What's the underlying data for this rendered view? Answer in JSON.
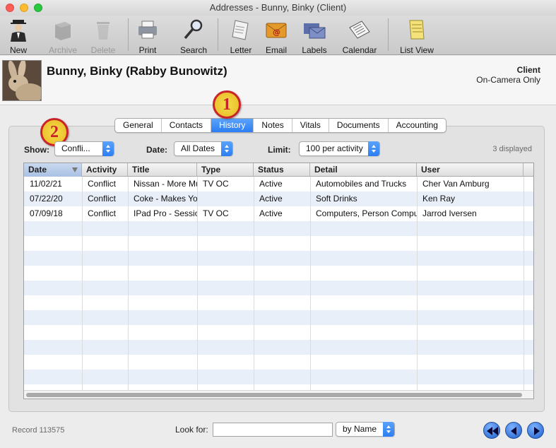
{
  "window": {
    "title": "Addresses - Bunny, Binky (Client)"
  },
  "toolbar": {
    "new": "New",
    "archive": "Archive",
    "delete": "Delete",
    "print": "Print",
    "search": "Search",
    "letter": "Letter",
    "email": "Email",
    "labels": "Labels",
    "calendar": "Calendar",
    "list_view": "List View"
  },
  "contact": {
    "name": "Bunny, Binky (Rabby Bunowitz)",
    "type": "Client",
    "category": "On-Camera Only"
  },
  "tabs": [
    {
      "label": "General"
    },
    {
      "label": "Contacts"
    },
    {
      "label": "History",
      "active": true
    },
    {
      "label": "Notes"
    },
    {
      "label": "Vitals"
    },
    {
      "label": "Documents"
    },
    {
      "label": "Accounting"
    }
  ],
  "callouts": [
    "1",
    "2"
  ],
  "filters": {
    "show_label": "Show:",
    "show_value": "Confli...",
    "date_label": "Date:",
    "date_value": "All Dates",
    "limit_label": "Limit:",
    "limit_value": "100 per activity",
    "count": "3 displayed"
  },
  "table": {
    "columns": [
      "Date",
      "Activity",
      "Title",
      "Type",
      "Status",
      "Detail",
      "User"
    ],
    "rows": [
      [
        "11/02/21",
        "Conflict",
        "Nissan - More Mu",
        "TV OC",
        "Active",
        "Automobiles and Trucks",
        "Cher Van Amburg"
      ],
      [
        "07/22/20",
        "Conflict",
        "Coke - Makes Yo",
        "",
        "Active",
        "Soft Drinks",
        "Ken Ray"
      ],
      [
        "07/09/18",
        "Conflict",
        "IPad Pro - Sessio",
        "TV OC",
        "Active",
        "Computers, Person Compu",
        "Jarrod Iversen"
      ]
    ]
  },
  "footer": {
    "record": "Record 113575",
    "look_for_label": "Look for:",
    "look_for_value": "",
    "by_value": "by Name"
  },
  "colors": {
    "accent": "#2c7ef3",
    "alt_row": "#e9eff9",
    "callout_border": "#c8242a"
  }
}
